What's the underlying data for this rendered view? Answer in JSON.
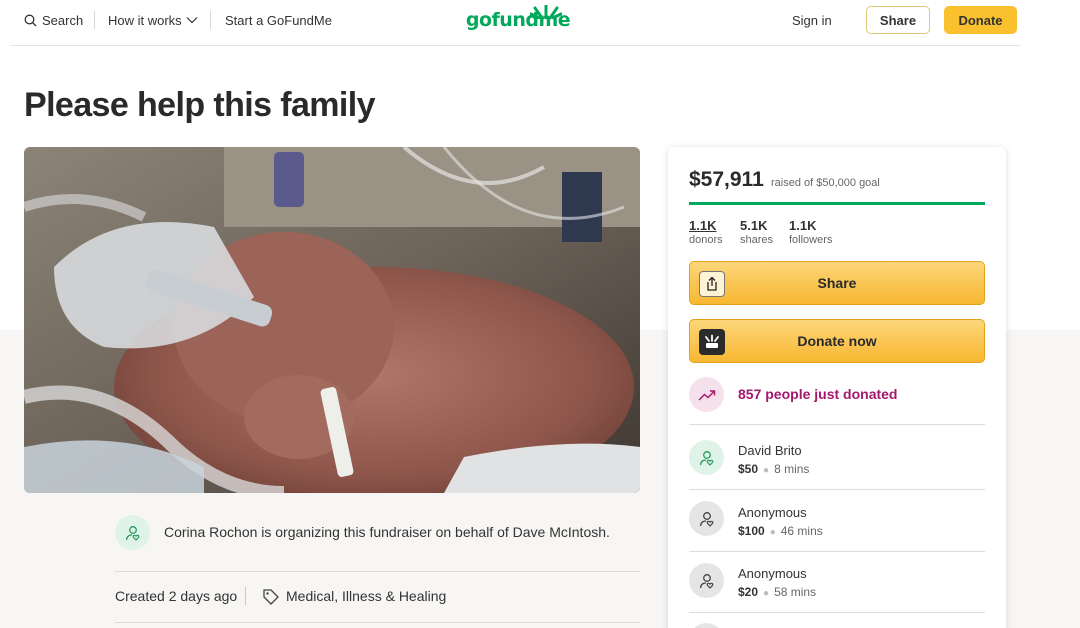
{
  "header": {
    "search_label": "Search",
    "how_it_works_label": "How it works",
    "start_label": "Start a GoFundMe",
    "logo_text": "gofundme",
    "signin_label": "Sign in",
    "share_label": "Share",
    "donate_label": "Donate"
  },
  "campaign": {
    "title": "Please help this family",
    "organizer_text": "Corina Rochon is organizing this fundraiser on behalf of Dave McIntosh.",
    "created_text": "Created 2 days ago",
    "category": "Medical, Illness & Healing"
  },
  "card": {
    "raised_amount": "$57,911",
    "raised_goal_text": "raised of $50,000 goal",
    "progress_fraction": 1.0,
    "stats": [
      {
        "value": "1.1K",
        "label": "donors"
      },
      {
        "value": "5.1K",
        "label": "shares"
      },
      {
        "value": "1.1K",
        "label": "followers"
      }
    ],
    "share_button_label": "Share",
    "donate_button_label": "Donate now",
    "trend_text": "857 people just donated",
    "donors": [
      {
        "name": "David Brito",
        "amount": "$50",
        "time": "8 mins"
      },
      {
        "name": "Anonymous",
        "amount": "$100",
        "time": "46 mins"
      },
      {
        "name": "Anonymous",
        "amount": "$20",
        "time": "58 mins"
      }
    ]
  },
  "colors": {
    "brand_green": "#02a95c",
    "donate_yellow": "#fbc02d",
    "trend_magenta": "#a3186b"
  },
  "icons": [
    "search-icon",
    "chevron-down-icon",
    "upload-icon",
    "gofundme-mark-icon",
    "trending-up-icon",
    "user-heart-icon",
    "tag-icon"
  ]
}
